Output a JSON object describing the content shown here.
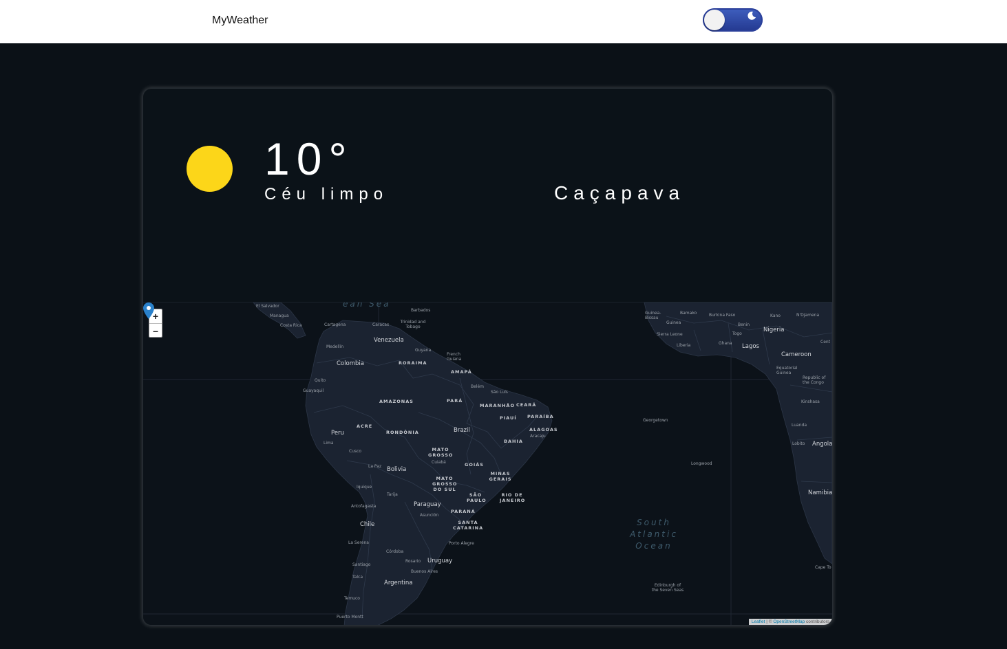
{
  "header": {
    "brand": "MyWeather",
    "theme_toggle_icon": "moon-icon"
  },
  "weather": {
    "icon": "sun-icon",
    "icon_color": "#fcd619",
    "temperature": "10°",
    "description": "Céu limpo",
    "city": "Caçapava"
  },
  "map": {
    "zoom_in_label": "+",
    "zoom_out_label": "–",
    "countries": {
      "venezuela": "Venezuela",
      "colombia": "Colombia",
      "peru": "Peru",
      "bolivia": "Bolivia",
      "brazil": "Brazil",
      "paraguay": "Paraguay",
      "chile": "Chile",
      "argentina": "Argentina",
      "uruguay": "Uruguay",
      "nigeria": "Nigeria",
      "cameroon": "Cameroon",
      "guinea": "Guinea",
      "ghana": "Ghana",
      "angola": "Angola",
      "namibia": "Namibia"
    },
    "states": {
      "amazonas": "AMAZONAS",
      "para": "PARÁ",
      "roraima": "RORAIMA",
      "amapa": "AMAPÁ",
      "maranhao": "MARANHÃO",
      "ceara": "CEARÁ",
      "piaui": "PIAUÍ",
      "paraiba": "PARAÍBA",
      "alagoas": "ALAGOAS",
      "bahia": "BAHIA",
      "acre": "ACRE",
      "rondonia": "RONDÔNIA",
      "mato_grosso": "MATO GROSSO",
      "goias": "GOIÁS",
      "minas_gerais": "MINAS GERAIS",
      "mato_grosso_do_sul": "MATO GROSSO DO SUL",
      "sao_paulo": "SÃO PAULO",
      "rio_de_janeiro": "RIO DE JANEIRO",
      "parana": "PARANÁ",
      "santa_catarina": "SANTA CATARINA"
    },
    "cities": {
      "el_salvador": "El Salvador",
      "managua": "Managua",
      "costa_rica": "Costa Rica",
      "cartagena": "Cartagena",
      "caracas": "Caracas",
      "trinidad": "Trinidad and Tobago",
      "barbados": "Barbados",
      "medellin": "Medellín",
      "guyana": "Guyana",
      "french_guiana": "French Guiana",
      "quito": "Quito",
      "guayaquil": "Guayaquil",
      "belem": "Belém",
      "sao_luis": "São Luís",
      "aracaju": "Aracaju",
      "lima": "Lima",
      "cusco": "Cusco",
      "cuiaba": "Cuiabá",
      "la_paz": "La Paz",
      "iquique": "Iquique",
      "tarija": "Tarija",
      "antofagasta": "Antofagasta",
      "asuncion": "Asunción",
      "porto_alegre": "Porto Alegre",
      "la_serena": "La Serena",
      "cordoba": "Córdoba",
      "santiago": "Santiago",
      "rosario": "Rosario",
      "buenos_aires": "Buenos Aires",
      "talca": "Talca",
      "temuco": "Temuco",
      "puerto_montt": "Puerto Montt",
      "georgetown": "Georgetown",
      "longwood": "Longwood",
      "edinburgh": "Edinburgh of the Seven Seas",
      "guinea_bissau": "Guinea-Bissau",
      "bamako": "Bamako",
      "burkina": "Burkina Faso",
      "kano": "Kano",
      "ndjamena": "N'Djamena",
      "sierra_leone": "Sierra Leone",
      "liberia": "Liberia",
      "benin": "Benin",
      "togo": "Togo",
      "lagos": "Lagos",
      "eq_guinea": "Equatorial Guinea",
      "rep_congo": "Republic of the Congo",
      "kinshasa": "Kinshasa",
      "luanda": "Luanda",
      "lobito": "Lobito",
      "cape_town": "Cape To",
      "central": "Cent"
    },
    "ocean": "South Atlantic Ocean",
    "sea": "ean Sea",
    "attribution_leaflet": "Leaflet",
    "attribution_osm": "OpenStreetMap",
    "attribution_rest": "contributors",
    "marker_icon": "map-pin-icon",
    "marker_color": "#2a81cb"
  }
}
